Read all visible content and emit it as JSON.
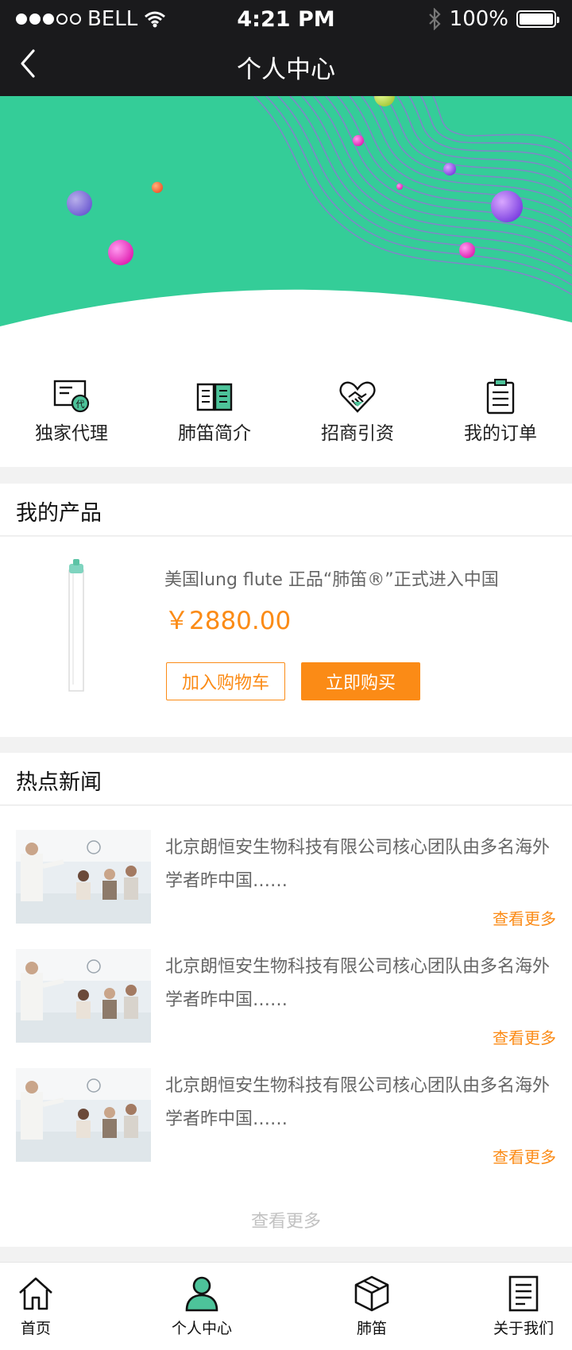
{
  "status_bar": {
    "carrier": "BELL",
    "time": "4:21 PM",
    "battery": "100%"
  },
  "nav": {
    "title": "个人中心"
  },
  "menu": [
    {
      "label": "独家代理",
      "icon": "agent-certificate-icon"
    },
    {
      "label": "肺笛简介",
      "icon": "open-book-icon"
    },
    {
      "label": "招商引资",
      "icon": "handshake-heart-icon"
    },
    {
      "label": "我的订单",
      "icon": "clipboard-icon"
    }
  ],
  "products_section": {
    "title": "我的产品"
  },
  "product": {
    "title": "美国lung flute 正品“肺笛®”正式进入中国",
    "price": "￥2880.00",
    "add_cart_label": "加入购物车",
    "buy_label": "立即购买"
  },
  "news_section": {
    "title": "热点新闻"
  },
  "news": [
    {
      "text": "北京朗恒安生物科技有限公司核心团队由多名海外学者昨中国……",
      "more": "查看更多"
    },
    {
      "text": "北京朗恒安生物科技有限公司核心团队由多名海外学者昨中国……",
      "more": "查看更多"
    },
    {
      "text": "北京朗恒安生物科技有限公司核心团队由多名海外学者昨中国……",
      "more": "查看更多"
    }
  ],
  "news_all_label": "查看更多",
  "tabbar": [
    {
      "label": "首页",
      "icon": "home-icon",
      "active": false
    },
    {
      "label": "个人中心",
      "icon": "user-icon",
      "active": true
    },
    {
      "label": "肺笛",
      "icon": "box-icon",
      "active": false
    },
    {
      "label": "关于我们",
      "icon": "document-icon",
      "active": false
    }
  ],
  "colors": {
    "accent": "#fb8b16",
    "banner": "#34cd98",
    "icon_green": "#4dc39a",
    "nav_bg": "#1a1a1c"
  }
}
